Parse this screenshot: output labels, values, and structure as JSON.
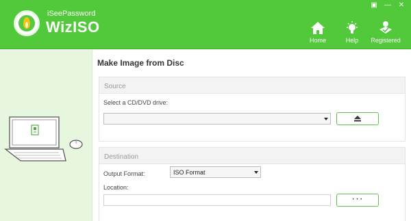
{
  "app": {
    "brand_sub": "iSeePassword",
    "brand_main": "WizISO"
  },
  "window_controls": {
    "pin": "▣",
    "minimize": "—",
    "close": "✕"
  },
  "nav": {
    "home": "Home",
    "help": "Help",
    "registered": "Registered"
  },
  "main": {
    "title": "Make Image from Disc",
    "source": {
      "legend": "Source",
      "drive_label": "Select a CD/DVD drive:",
      "drive_value": ""
    },
    "destination": {
      "legend": "Destination",
      "format_label": "Output Format:",
      "format_value": "ISO Format",
      "location_label": "Location:",
      "location_value": "",
      "browse_label": "• • •"
    }
  },
  "colors": {
    "accent": "#52c93a",
    "left_panel": "#e7f7df",
    "button_border": "#5fc24a"
  },
  "icons": {
    "logo": "flame-logo-icon",
    "home": "home-icon",
    "help": "lightbulb-icon",
    "registered": "registered-user-icon",
    "eject": "eject-icon",
    "illustration": "laptop-mouse-illustration"
  }
}
